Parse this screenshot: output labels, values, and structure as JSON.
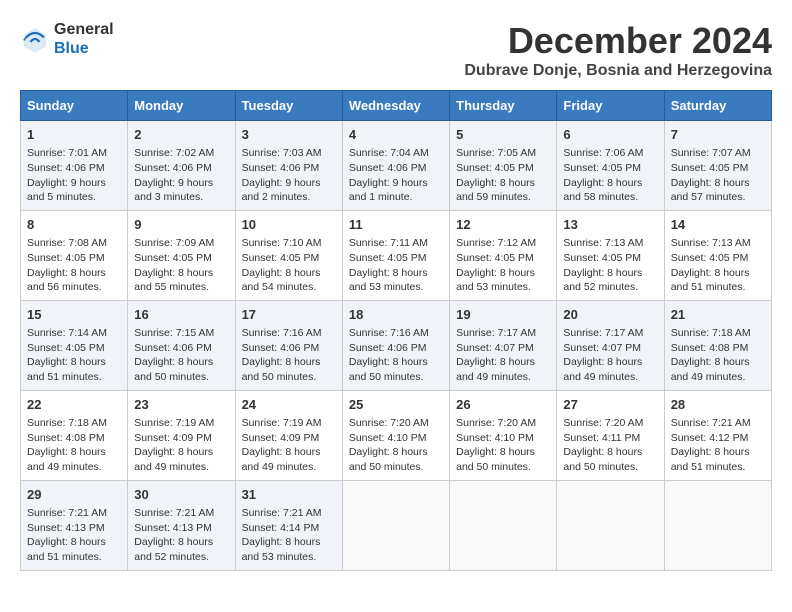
{
  "header": {
    "logo_general": "General",
    "logo_blue": "Blue",
    "month": "December 2024",
    "location": "Dubrave Donje, Bosnia and Herzegovina"
  },
  "weekdays": [
    "Sunday",
    "Monday",
    "Tuesday",
    "Wednesday",
    "Thursday",
    "Friday",
    "Saturday"
  ],
  "weeks": [
    [
      {
        "day": "1",
        "lines": [
          "Sunrise: 7:01 AM",
          "Sunset: 4:06 PM",
          "Daylight: 9 hours",
          "and 5 minutes."
        ]
      },
      {
        "day": "2",
        "lines": [
          "Sunrise: 7:02 AM",
          "Sunset: 4:06 PM",
          "Daylight: 9 hours",
          "and 3 minutes."
        ]
      },
      {
        "day": "3",
        "lines": [
          "Sunrise: 7:03 AM",
          "Sunset: 4:06 PM",
          "Daylight: 9 hours",
          "and 2 minutes."
        ]
      },
      {
        "day": "4",
        "lines": [
          "Sunrise: 7:04 AM",
          "Sunset: 4:06 PM",
          "Daylight: 9 hours",
          "and 1 minute."
        ]
      },
      {
        "day": "5",
        "lines": [
          "Sunrise: 7:05 AM",
          "Sunset: 4:05 PM",
          "Daylight: 8 hours",
          "and 59 minutes."
        ]
      },
      {
        "day": "6",
        "lines": [
          "Sunrise: 7:06 AM",
          "Sunset: 4:05 PM",
          "Daylight: 8 hours",
          "and 58 minutes."
        ]
      },
      {
        "day": "7",
        "lines": [
          "Sunrise: 7:07 AM",
          "Sunset: 4:05 PM",
          "Daylight: 8 hours",
          "and 57 minutes."
        ]
      }
    ],
    [
      {
        "day": "8",
        "lines": [
          "Sunrise: 7:08 AM",
          "Sunset: 4:05 PM",
          "Daylight: 8 hours",
          "and 56 minutes."
        ]
      },
      {
        "day": "9",
        "lines": [
          "Sunrise: 7:09 AM",
          "Sunset: 4:05 PM",
          "Daylight: 8 hours",
          "and 55 minutes."
        ]
      },
      {
        "day": "10",
        "lines": [
          "Sunrise: 7:10 AM",
          "Sunset: 4:05 PM",
          "Daylight: 8 hours",
          "and 54 minutes."
        ]
      },
      {
        "day": "11",
        "lines": [
          "Sunrise: 7:11 AM",
          "Sunset: 4:05 PM",
          "Daylight: 8 hours",
          "and 53 minutes."
        ]
      },
      {
        "day": "12",
        "lines": [
          "Sunrise: 7:12 AM",
          "Sunset: 4:05 PM",
          "Daylight: 8 hours",
          "and 53 minutes."
        ]
      },
      {
        "day": "13",
        "lines": [
          "Sunrise: 7:13 AM",
          "Sunset: 4:05 PM",
          "Daylight: 8 hours",
          "and 52 minutes."
        ]
      },
      {
        "day": "14",
        "lines": [
          "Sunrise: 7:13 AM",
          "Sunset: 4:05 PM",
          "Daylight: 8 hours",
          "and 51 minutes."
        ]
      }
    ],
    [
      {
        "day": "15",
        "lines": [
          "Sunrise: 7:14 AM",
          "Sunset: 4:05 PM",
          "Daylight: 8 hours",
          "and 51 minutes."
        ]
      },
      {
        "day": "16",
        "lines": [
          "Sunrise: 7:15 AM",
          "Sunset: 4:06 PM",
          "Daylight: 8 hours",
          "and 50 minutes."
        ]
      },
      {
        "day": "17",
        "lines": [
          "Sunrise: 7:16 AM",
          "Sunset: 4:06 PM",
          "Daylight: 8 hours",
          "and 50 minutes."
        ]
      },
      {
        "day": "18",
        "lines": [
          "Sunrise: 7:16 AM",
          "Sunset: 4:06 PM",
          "Daylight: 8 hours",
          "and 50 minutes."
        ]
      },
      {
        "day": "19",
        "lines": [
          "Sunrise: 7:17 AM",
          "Sunset: 4:07 PM",
          "Daylight: 8 hours",
          "and 49 minutes."
        ]
      },
      {
        "day": "20",
        "lines": [
          "Sunrise: 7:17 AM",
          "Sunset: 4:07 PM",
          "Daylight: 8 hours",
          "and 49 minutes."
        ]
      },
      {
        "day": "21",
        "lines": [
          "Sunrise: 7:18 AM",
          "Sunset: 4:08 PM",
          "Daylight: 8 hours",
          "and 49 minutes."
        ]
      }
    ],
    [
      {
        "day": "22",
        "lines": [
          "Sunrise: 7:18 AM",
          "Sunset: 4:08 PM",
          "Daylight: 8 hours",
          "and 49 minutes."
        ]
      },
      {
        "day": "23",
        "lines": [
          "Sunrise: 7:19 AM",
          "Sunset: 4:09 PM",
          "Daylight: 8 hours",
          "and 49 minutes."
        ]
      },
      {
        "day": "24",
        "lines": [
          "Sunrise: 7:19 AM",
          "Sunset: 4:09 PM",
          "Daylight: 8 hours",
          "and 49 minutes."
        ]
      },
      {
        "day": "25",
        "lines": [
          "Sunrise: 7:20 AM",
          "Sunset: 4:10 PM",
          "Daylight: 8 hours",
          "and 50 minutes."
        ]
      },
      {
        "day": "26",
        "lines": [
          "Sunrise: 7:20 AM",
          "Sunset: 4:10 PM",
          "Daylight: 8 hours",
          "and 50 minutes."
        ]
      },
      {
        "day": "27",
        "lines": [
          "Sunrise: 7:20 AM",
          "Sunset: 4:11 PM",
          "Daylight: 8 hours",
          "and 50 minutes."
        ]
      },
      {
        "day": "28",
        "lines": [
          "Sunrise: 7:21 AM",
          "Sunset: 4:12 PM",
          "Daylight: 8 hours",
          "and 51 minutes."
        ]
      }
    ],
    [
      {
        "day": "29",
        "lines": [
          "Sunrise: 7:21 AM",
          "Sunset: 4:13 PM",
          "Daylight: 8 hours",
          "and 51 minutes."
        ]
      },
      {
        "day": "30",
        "lines": [
          "Sunrise: 7:21 AM",
          "Sunset: 4:13 PM",
          "Daylight: 8 hours",
          "and 52 minutes."
        ]
      },
      {
        "day": "31",
        "lines": [
          "Sunrise: 7:21 AM",
          "Sunset: 4:14 PM",
          "Daylight: 8 hours",
          "and 53 minutes."
        ]
      },
      {
        "day": "",
        "lines": []
      },
      {
        "day": "",
        "lines": []
      },
      {
        "day": "",
        "lines": []
      },
      {
        "day": "",
        "lines": []
      }
    ]
  ]
}
